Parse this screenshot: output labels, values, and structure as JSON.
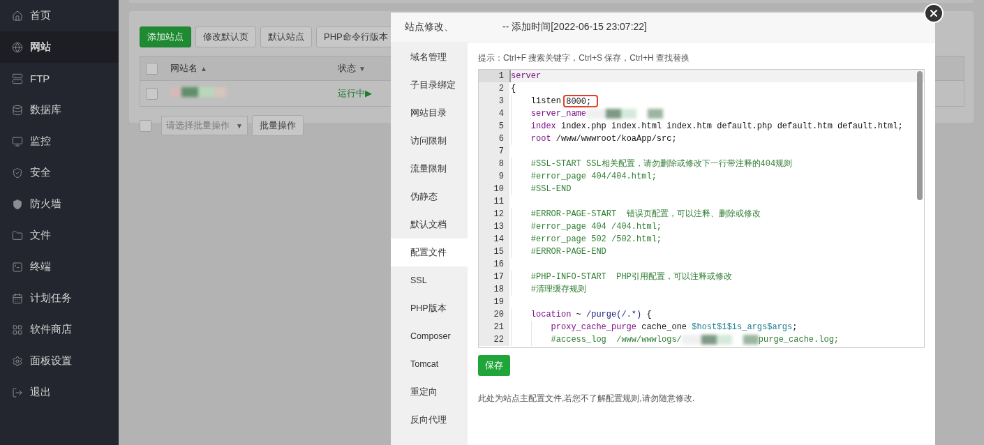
{
  "sidebar": {
    "items": [
      {
        "label": "首页",
        "selected": false
      },
      {
        "label": "网站",
        "selected": true
      },
      {
        "label": "FTP",
        "selected": false
      },
      {
        "label": "数据库",
        "selected": false
      },
      {
        "label": "监控",
        "selected": false
      },
      {
        "label": "安全",
        "selected": false
      },
      {
        "label": "防火墙",
        "selected": false
      },
      {
        "label": "文件",
        "selected": false
      },
      {
        "label": "终端",
        "selected": false
      },
      {
        "label": "计划任务",
        "selected": false
      },
      {
        "label": "软件商店",
        "selected": false
      },
      {
        "label": "面板设置",
        "selected": false
      },
      {
        "label": "退出",
        "selected": false
      }
    ]
  },
  "toolbar": {
    "buttons": [
      {
        "label": "添加站点",
        "primary": true
      },
      {
        "label": "修改默认页",
        "primary": false
      },
      {
        "label": "默认站点",
        "primary": false
      },
      {
        "label": "PHP命令行版本",
        "primary": false
      }
    ]
  },
  "table": {
    "select_all": {
      "checked": false
    },
    "columns": [
      {
        "label": "网站名",
        "sort_icon": "▲"
      },
      {
        "label": "状态",
        "sort_icon": "▼"
      }
    ],
    "rows": [
      {
        "checked": false,
        "status": "运行中▶"
      }
    ]
  },
  "batch": {
    "checked": false,
    "placeholder": "请选择批量操作",
    "caret": "▼",
    "button": "批量操作"
  },
  "dialog": {
    "title_prefix": "站点修改、",
    "title_suffix": "-- 添加时间[2022-06-15 23:07:22]",
    "tabs": [
      {
        "label": "域名管理",
        "selected": false
      },
      {
        "label": "子目录绑定",
        "selected": false
      },
      {
        "label": "网站目录",
        "selected": false
      },
      {
        "label": "访问限制",
        "selected": false
      },
      {
        "label": "流量限制",
        "selected": false
      },
      {
        "label": "伪静态",
        "selected": false
      },
      {
        "label": "默认文档",
        "selected": false
      },
      {
        "label": "配置文件",
        "selected": true
      },
      {
        "label": "SSL",
        "selected": false
      },
      {
        "label": "PHP版本",
        "selected": false
      },
      {
        "label": "Composer",
        "selected": false
      },
      {
        "label": "Tomcat",
        "selected": false
      },
      {
        "label": "重定向",
        "selected": false
      },
      {
        "label": "反向代理",
        "selected": false
      }
    ],
    "hint": "提示：Ctrl+F 搜索关键字，Ctrl+S 保存，Ctrl+H 查找替换",
    "code": [
      {
        "number": "1",
        "active": true,
        "tokens": [
          {
            "text": "server",
            "kind": "keyword"
          }
        ]
      },
      {
        "number": "2",
        "active": false,
        "tokens": [
          {
            "text": "{",
            "kind": "plain"
          }
        ]
      },
      {
        "number": "3",
        "active": false,
        "tokens": [
          {
            "text": "    listen ",
            "kind": "plain"
          },
          {
            "text": "8000;",
            "kind": "plain",
            "boxed": true
          }
        ]
      },
      {
        "number": "4",
        "active": false,
        "tokens": [
          {
            "text": "    server_name",
            "kind": "keyword"
          },
          {
            "kind": "redacted"
          }
        ]
      },
      {
        "number": "5",
        "active": false,
        "tokens": [
          {
            "text": "    index",
            "kind": "keyword"
          },
          {
            "text": " index.php index.html index.htm default.php default.htm default.html;",
            "kind": "plain"
          }
        ]
      },
      {
        "number": "6",
        "active": false,
        "tokens": [
          {
            "text": "    root",
            "kind": "keyword"
          },
          {
            "text": " /www/wwwroot/koaApp/src;",
            "kind": "plain"
          }
        ]
      },
      {
        "number": "7",
        "active": false
      },
      {
        "number": "8",
        "active": false,
        "tokens": [
          {
            "text": "    #SSL-START SSL相关配置，请勿删除或修改下一行带注释的404规则",
            "kind": "comment"
          }
        ]
      },
      {
        "number": "9",
        "active": false,
        "tokens": [
          {
            "text": "    #error_page 404/404.html;",
            "kind": "comment"
          }
        ]
      },
      {
        "number": "10",
        "active": false,
        "tokens": [
          {
            "text": "    #SSL-END",
            "kind": "comment"
          }
        ]
      },
      {
        "number": "11",
        "active": false
      },
      {
        "number": "12",
        "active": false,
        "tokens": [
          {
            "text": "    #ERROR-PAGE-START  错误页配置，可以注释、删除或修改",
            "kind": "comment"
          }
        ]
      },
      {
        "number": "13",
        "active": false,
        "tokens": [
          {
            "text": "    #error_page 404 /404.html;",
            "kind": "comment"
          }
        ]
      },
      {
        "number": "14",
        "active": false,
        "tokens": [
          {
            "text": "    #error_page 502 /502.html;",
            "kind": "comment"
          }
        ]
      },
      {
        "number": "15",
        "active": false,
        "tokens": [
          {
            "text": "    #ERROR-PAGE-END",
            "kind": "comment"
          }
        ]
      },
      {
        "number": "16",
        "active": false
      },
      {
        "number": "17",
        "active": false,
        "tokens": [
          {
            "text": "    #PHP-INFO-START  PHP引用配置，可以注释或修改",
            "kind": "comment"
          }
        ]
      },
      {
        "number": "18",
        "active": false,
        "tokens": [
          {
            "text": "    #清理缓存规则",
            "kind": "comment"
          }
        ]
      },
      {
        "number": "19",
        "active": false
      },
      {
        "number": "20",
        "active": false,
        "tokens": [
          {
            "text": "    location",
            "kind": "keyword"
          },
          {
            "text": " ~ ",
            "kind": "plain"
          },
          {
            "text": "/purge(/.*)",
            "kind": "string"
          },
          {
            "text": " {",
            "kind": "plain"
          }
        ]
      },
      {
        "number": "21",
        "active": false,
        "tokens": [
          {
            "text": "        proxy_cache_purge",
            "kind": "keyword"
          },
          {
            "text": " cache_one ",
            "kind": "plain"
          },
          {
            "text": "$host$1$is_args$args",
            "kind": "variable"
          },
          {
            "text": ";",
            "kind": "plain"
          }
        ]
      },
      {
        "number": "22",
        "active": false,
        "tokens": [
          {
            "text": "        #access_log  /www/wwwlogs/",
            "kind": "comment"
          },
          {
            "kind": "redacted"
          },
          {
            "text": "purge_cache.log;",
            "kind": "comment"
          }
        ]
      }
    ],
    "save": "保存",
    "note": "此处为站点主配置文件,若您不了解配置规则,请勿随意修改."
  }
}
